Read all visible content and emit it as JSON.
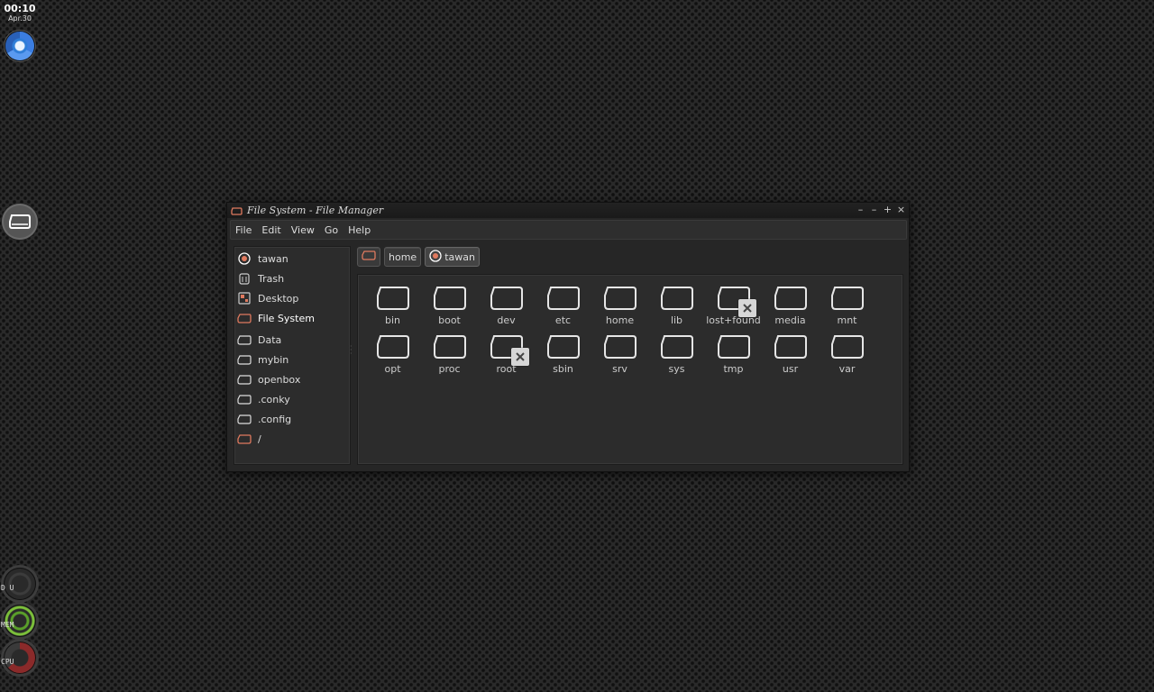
{
  "clock": {
    "time": "00:10",
    "date": "Apr.30"
  },
  "dock": {
    "gauges": [
      {
        "label": "D U"
      },
      {
        "label": "MEM"
      },
      {
        "label": "CPU"
      }
    ]
  },
  "window": {
    "title": "File System - File Manager",
    "controls": [
      "–",
      "–",
      "+",
      "×"
    ]
  },
  "menu": [
    "File",
    "Edit",
    "View",
    "Go",
    "Help"
  ],
  "sidebar": {
    "places": [
      {
        "label": "tawan",
        "icon": "home-icon"
      },
      {
        "label": "Trash",
        "icon": "trash-icon"
      },
      {
        "label": "Desktop",
        "icon": "desktop-icon"
      },
      {
        "label": "File System",
        "icon": "drive-icon"
      }
    ],
    "bookmarks": [
      {
        "label": "Data",
        "icon": "folder-icon"
      },
      {
        "label": "mybin",
        "icon": "folder-icon"
      },
      {
        "label": "openbox",
        "icon": "folder-icon"
      },
      {
        "label": ".conky",
        "icon": "folder-icon"
      },
      {
        "label": ".config",
        "icon": "folder-icon"
      },
      {
        "label": "/",
        "icon": "drive-icon"
      }
    ]
  },
  "pathbar": [
    {
      "label": "",
      "icon": "drive-icon"
    },
    {
      "label": "home",
      "icon": ""
    },
    {
      "label": "tawan",
      "icon": "home-icon"
    }
  ],
  "files": [
    {
      "name": "bin",
      "locked": false
    },
    {
      "name": "boot",
      "locked": false
    },
    {
      "name": "dev",
      "locked": false
    },
    {
      "name": "etc",
      "locked": false
    },
    {
      "name": "home",
      "locked": false
    },
    {
      "name": "lib",
      "locked": false
    },
    {
      "name": "lost+found",
      "locked": true
    },
    {
      "name": "media",
      "locked": false
    },
    {
      "name": "mnt",
      "locked": false
    },
    {
      "name": "opt",
      "locked": false
    },
    {
      "name": "proc",
      "locked": false
    },
    {
      "name": "root",
      "locked": true
    },
    {
      "name": "sbin",
      "locked": false
    },
    {
      "name": "srv",
      "locked": false
    },
    {
      "name": "sys",
      "locked": false
    },
    {
      "name": "tmp",
      "locked": false
    },
    {
      "name": "usr",
      "locked": false
    },
    {
      "name": "var",
      "locked": false
    }
  ],
  "colors": {
    "accent": "#e07a5f",
    "text": "#dddddd"
  }
}
